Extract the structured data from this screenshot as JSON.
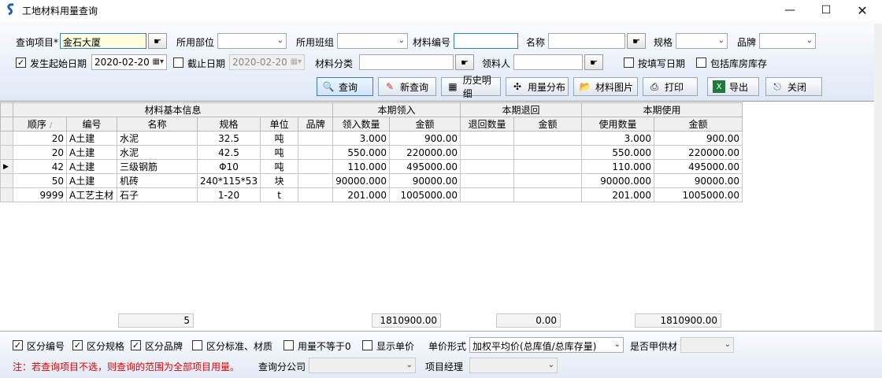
{
  "window": {
    "title": "工地材料用量查询"
  },
  "query": {
    "project_label": "查询项目*",
    "project_value": "金石大厦",
    "dept_label": "所用部位",
    "team_label": "所用班组",
    "material_code_label": "材料编号",
    "name_label": "名称",
    "spec_label": "规格",
    "brand_label": "品牌",
    "start_date_label": "发生起始日期",
    "start_date_value": "2020-02-20",
    "end_date_label": "截止日期",
    "end_date_value": "2020-02-20",
    "category_label": "材料分类",
    "receiver_label": "领料人",
    "by_fill_date_label": "按填写日期",
    "include_warehouse_label": "包括库房库存"
  },
  "toolbar": {
    "query": "查询",
    "new_query": "新查询",
    "history": "历史明细",
    "distribution": "用量分布",
    "pictures": "材料图片",
    "print": "打印",
    "export": "导出",
    "close": "关闭"
  },
  "grid": {
    "groups": [
      "材料基本信息",
      "本期领入",
      "本期退回",
      "本期使用"
    ],
    "columns": [
      "顺序",
      "编号",
      "名称",
      "规格",
      "单位",
      "品牌",
      "领入数量",
      "金额",
      "退回数量",
      "金额",
      "使用数量",
      "金额"
    ],
    "rows": [
      [
        "20",
        "A土建",
        "水泥",
        "32.5",
        "吨",
        "",
        "3.000",
        "900.00",
        "",
        "",
        "3.000",
        "900.00"
      ],
      [
        "20",
        "A土建",
        "水泥",
        "42.5",
        "吨",
        "",
        "550.000",
        "220000.00",
        "",
        "",
        "550.000",
        "220000.00"
      ],
      [
        "42",
        "A土建",
        "三级钢筋",
        "Φ10",
        "吨",
        "",
        "110.000",
        "495000.00",
        "",
        "",
        "110.000",
        "495000.00"
      ],
      [
        "50",
        "A土建",
        "机砖",
        "240*115*53",
        "块",
        "",
        "90000.000",
        "90000.00",
        "",
        "",
        "90000.000",
        "90000.00"
      ],
      [
        "9999",
        "A工艺主材",
        "石子",
        "1-20",
        "t",
        "",
        "201.000",
        "1005000.00",
        "",
        "",
        "201.000",
        "1005000.00"
      ]
    ],
    "totals": {
      "count": "5",
      "in_amount": "1810900.00",
      "return_amount": "0.00",
      "use_amount": "1810900.00"
    }
  },
  "options": {
    "by_code": "区分编号",
    "by_spec": "区分规格",
    "by_brand": "区分品牌",
    "by_standard": "区分标准、材质",
    "not_equal": "用量不等于0",
    "show_price": "显示单价",
    "price_mode_label": "单价形式",
    "price_mode_value": "加权平均价(总库值/总库存量)",
    "owner_supply_label": "是否甲供材",
    "note": "注：若查询项目不选，则查询的范围为全部项目用量。",
    "branch_label": "查询分公司",
    "manager_label": "项目经理"
  }
}
